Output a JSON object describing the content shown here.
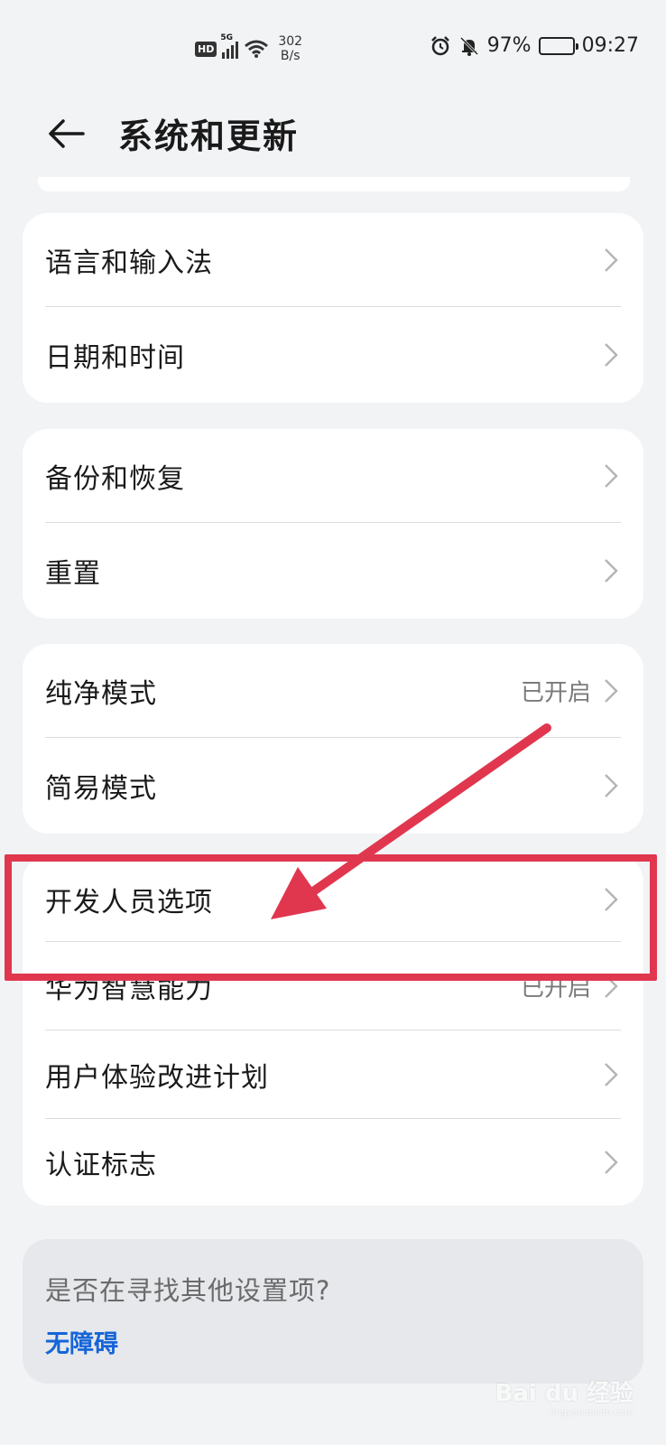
{
  "status_bar": {
    "hd": "HD",
    "network": "5G",
    "speed_value": "302",
    "speed_unit": "B/s",
    "battery": "97%",
    "battery_level": 0.97,
    "time": "09:27"
  },
  "header": {
    "title": "系统和更新"
  },
  "groups": [
    {
      "items": [
        {
          "label": "语言和输入法",
          "value": ""
        },
        {
          "label": "日期和时间",
          "value": ""
        }
      ]
    },
    {
      "items": [
        {
          "label": "备份和恢复",
          "value": ""
        },
        {
          "label": "重置",
          "value": ""
        }
      ]
    },
    {
      "items": [
        {
          "label": "纯净模式",
          "value": "已开启"
        },
        {
          "label": "简易模式",
          "value": ""
        }
      ]
    },
    {
      "items": [
        {
          "label": "开发人员选项",
          "value": ""
        },
        {
          "label": "华为智慧能力",
          "value": "已开启"
        },
        {
          "label": "用户体验改进计划",
          "value": ""
        },
        {
          "label": "认证标志",
          "value": ""
        }
      ]
    }
  ],
  "search_hint": {
    "question": "是否在寻找其他设置项?",
    "link": "无障碍"
  },
  "watermark": {
    "brand": "Bai du 经验",
    "url": "jingyan.baidu.com"
  },
  "colors": {
    "background": "#f1f3f5",
    "highlight": "#e0374f",
    "link": "#1565d8"
  }
}
